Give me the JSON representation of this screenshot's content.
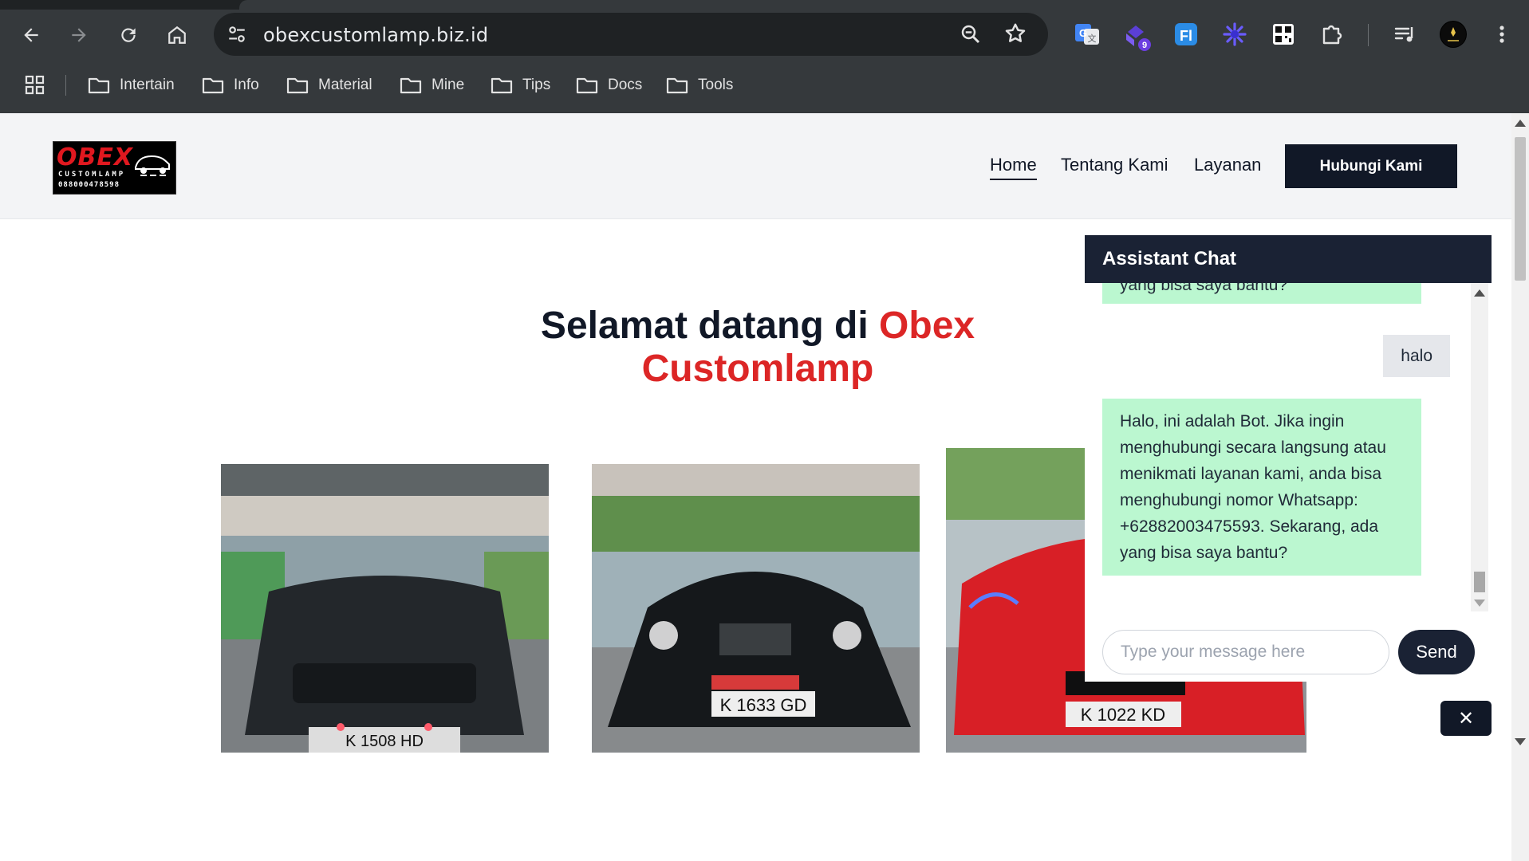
{
  "browser": {
    "url": "obexcustomlamp.biz.id",
    "extension_badge": "9",
    "bookmarks": [
      "Intertain",
      "Info",
      "Material",
      "Mine",
      "Tips",
      "Docs",
      "Tools"
    ],
    "icons": [
      "back-icon",
      "forward-icon",
      "reload-icon",
      "home-icon",
      "site-settings-icon",
      "zoom-icon",
      "star-icon",
      "google-translate-icon",
      "extension-icon",
      "fi-extension-icon",
      "sparkle-extension-icon",
      "qr-icon",
      "puzzle-icon",
      "reading-list-icon",
      "profile-icon",
      "menu-icon",
      "apps-icon",
      "folder-icon"
    ]
  },
  "site": {
    "logo": {
      "title": "OBEX",
      "subtitle": "CUSTOMLAMP",
      "phone": "088000478598"
    },
    "nav": [
      "Home",
      "Tentang Kami",
      "Layanan"
    ],
    "cta": "Hubungi Kami",
    "hero": {
      "prefix": "Selamat datang di",
      "brand_line1": "Obex",
      "brand_line2": "Customlamp"
    },
    "photos": [
      {
        "plate": "K 1508 HD",
        "car_color": "#23272b"
      },
      {
        "plate": "K 1633 GD",
        "car_color": "#15181b"
      },
      {
        "plate": "K 1022 KD",
        "car_color": "#d81f26"
      }
    ]
  },
  "chat": {
    "title": "Assistant Chat",
    "messages": [
      {
        "from": "bot",
        "text": "yang bisa saya bantu?"
      },
      {
        "from": "user",
        "text": "halo"
      },
      {
        "from": "bot",
        "lines": [
          "Halo, ini adalah Bot. Jika ingin",
          "menghubungi secara langsung atau",
          "menikmati layanan kami, anda bisa",
          "menghubungi nomor Whatsapp:",
          "+62882003475593. Sekarang, ada",
          "yang bisa saya bantu?"
        ]
      }
    ],
    "input_placeholder": "Type your message here",
    "send_label": "Send",
    "close_label": "✕"
  },
  "colors": {
    "brand_red": "#dc2626",
    "navy": "#111827",
    "bot_bubble": "#bbf7d0",
    "user_bubble": "#e5e7eb"
  }
}
